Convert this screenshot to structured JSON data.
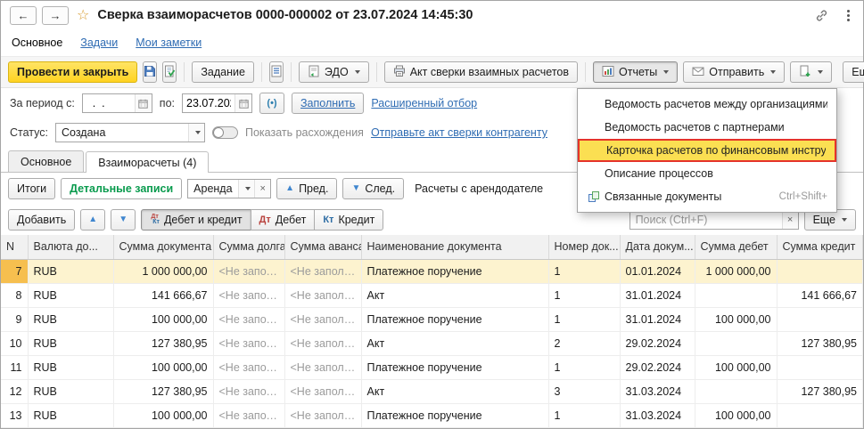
{
  "header": {
    "title": "Сверка взаиморасчетов 0000-000002 от 23.07.2024 14:45:30",
    "back_icon": "←",
    "forward_icon": "→",
    "favorite_icon": "☆"
  },
  "nav": {
    "tabs": [
      {
        "label": "Основное",
        "active": true
      },
      {
        "label": "Задачи",
        "active": false
      },
      {
        "label": "Мои заметки",
        "active": false
      }
    ]
  },
  "toolbar": {
    "post_and_close": "Провести и закрыть",
    "task": "Задание",
    "edo": "ЭДО",
    "reconciliation_act": "Акт сверки взаимных расчетов",
    "reports": "Отчеты",
    "send": "Отправить",
    "more": "Еще"
  },
  "reports_menu": {
    "items": [
      {
        "label": "Ведомость расчетов между организациями",
        "highlighted": false
      },
      {
        "label": "Ведомость расчетов с партнерами",
        "highlighted": false
      },
      {
        "label": "Карточка расчетов по финансовым инструментам",
        "highlighted": true
      },
      {
        "label": "Описание процессов",
        "highlighted": false
      },
      {
        "label": "Связанные документы",
        "highlighted": false,
        "shortcut": "Ctrl+Shift+"
      }
    ]
  },
  "period": {
    "from_label": "За период с:",
    "from_value": "  .  .",
    "to_label": "по:",
    "to_value": "23.07.2024",
    "pick_icon": "(•)",
    "fill_label": "Заполнить",
    "advanced_label": "Расширенный отбор"
  },
  "status": {
    "label": "Статус:",
    "value": "Создана",
    "toggle_label": "Показать расхождения",
    "send_act_link": "Отправьте акт сверки контрагенту"
  },
  "doc_tabs": [
    {
      "label": "Основное",
      "active": false
    },
    {
      "label": "Взаиморасчеты (4)",
      "active": true
    }
  ],
  "view_bar": {
    "totals": "Итоги",
    "detailed": "Детальные записи",
    "contract_value": "Аренда",
    "prev": "Пред.",
    "next": "След.",
    "caption": "Расчеты с арендодателе"
  },
  "grid_bar": {
    "add": "Добавить",
    "dt": "Дт",
    "kt": "Кт",
    "debit_credit": "Дебет и кредит",
    "debit": "Дебет",
    "credit": "Кредит",
    "search_placeholder": "Поиск (Ctrl+F)",
    "more": "Еще"
  },
  "table": {
    "columns": [
      "N",
      "Валюта до...",
      "Сумма документа",
      "Сумма долга",
      "Сумма аванса",
      "Наименование документа",
      "Номер док...",
      "Дата докум...",
      "Сумма дебет",
      "Сумма кредит"
    ],
    "rows": [
      {
        "selected": true,
        "cells": [
          "7",
          "RUB",
          "1 000 000,00",
          "<Не запол...",
          "<Не заполн...",
          "Платежное поручение",
          "1",
          "01.01.2024",
          "1 000 000,00",
          ""
        ]
      },
      {
        "selected": false,
        "cells": [
          "8",
          "RUB",
          "141 666,67",
          "<Не запол...",
          "<Не заполн...",
          "Акт",
          "1",
          "31.01.2024",
          "",
          "141 666,67"
        ]
      },
      {
        "selected": false,
        "cells": [
          "9",
          "RUB",
          "100 000,00",
          "<Не запол...",
          "<Не заполн...",
          "Платежное поручение",
          "1",
          "31.01.2024",
          "100 000,00",
          ""
        ]
      },
      {
        "selected": false,
        "cells": [
          "10",
          "RUB",
          "127 380,95",
          "<Не запол...",
          "<Не заполн...",
          "Акт",
          "2",
          "29.02.2024",
          "",
          "127 380,95"
        ]
      },
      {
        "selected": false,
        "cells": [
          "11",
          "RUB",
          "100 000,00",
          "<Не запол...",
          "<Не заполн...",
          "Платежное поручение",
          "1",
          "29.02.2024",
          "100 000,00",
          ""
        ]
      },
      {
        "selected": false,
        "cells": [
          "12",
          "RUB",
          "127 380,95",
          "<Не запол...",
          "<Не заполн...",
          "Акт",
          "3",
          "31.03.2024",
          "",
          "127 380,95"
        ]
      },
      {
        "selected": false,
        "cells": [
          "13",
          "RUB",
          "100 000,00",
          "<Не запол...",
          "<Не заполн...",
          "Платежное поручение",
          "1",
          "31.03.2024",
          "100 000,00",
          ""
        ]
      }
    ]
  }
}
